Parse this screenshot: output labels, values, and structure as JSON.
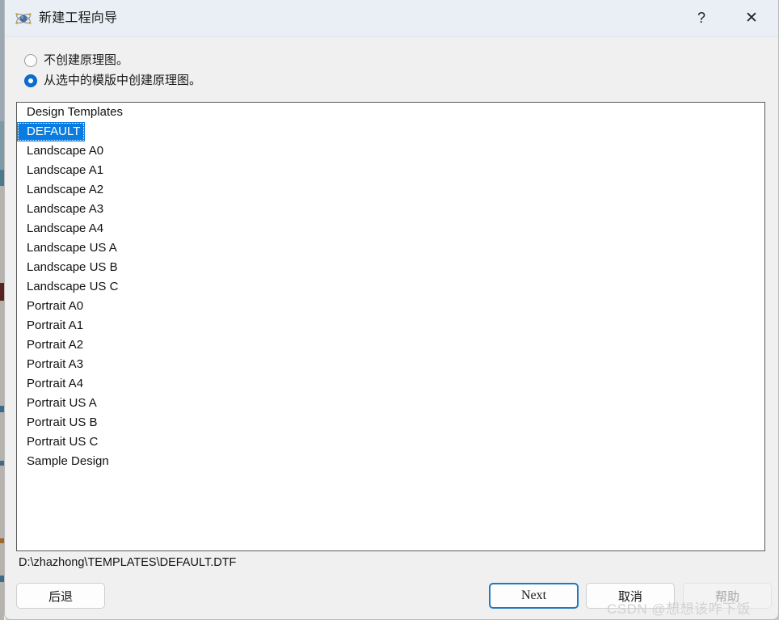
{
  "window": {
    "title": "新建工程向导",
    "icon": "atom-icon",
    "help_caption": "?",
    "close_caption": "✕"
  },
  "options": {
    "no_schematic": {
      "label": "不创建原理图。",
      "selected": false
    },
    "from_template": {
      "label": "从选中的模版中创建原理图。",
      "selected": true
    }
  },
  "template_list": {
    "items": [
      "Design Templates",
      "DEFAULT",
      "Landscape A0",
      "Landscape A1",
      "Landscape A2",
      "Landscape A3",
      "Landscape A4",
      "Landscape US A",
      "Landscape US B",
      "Landscape US C",
      "Portrait A0",
      "Portrait A1",
      "Portrait A2",
      "Portrait A3",
      "Portrait A4",
      "Portrait US A",
      "Portrait US B",
      "Portrait US C",
      "Sample Design"
    ],
    "selected_index": 1,
    "selected_value": "DEFAULT"
  },
  "path_label": "D:\\zhazhong\\TEMPLATES\\DEFAULT.DTF",
  "footer": {
    "back_label": "后退",
    "next_label": "Next",
    "cancel_label": "取消",
    "help_label": "帮助"
  },
  "watermark": "CSDN @想想该咋下饭",
  "colors": {
    "selection_blue": "#0a7ce0",
    "radio_blue": "#0a6ed1",
    "focus_border": "#1f7ac0",
    "titlebar": "#eaeff5",
    "dialog_bg": "#f0f0f0"
  }
}
